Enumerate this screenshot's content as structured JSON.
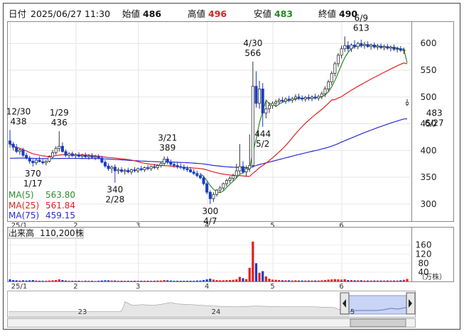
{
  "header": {
    "label_date": "日付",
    "date": "2025/06/27 11:30",
    "label_open": "始値",
    "open": "486",
    "label_high": "高値",
    "high": "496",
    "label_low": "安値",
    "low": "483",
    "label_close": "終値",
    "close": "490"
  },
  "legend": {
    "ma5_label": "MA(5)",
    "ma5_value": "563.80",
    "ma25_label": "MA(25)",
    "ma25_value": "561.84",
    "ma75_label": "MA(75)",
    "ma75_value": "459.15"
  },
  "volume_header": {
    "label": "出来高",
    "value": "110,200株"
  },
  "volume_unit": "（万株）",
  "colors": {
    "up": "#ffffff",
    "down": "#1a3cc8",
    "vol_up": "#e02020",
    "vol_down": "#1a3cc8",
    "ma5": "#2c8a2c",
    "ma25": "#e02020",
    "ma75": "#2a2ad8",
    "high_value": "#e02020",
    "low_value": "#228822"
  },
  "annotations": [
    {
      "date_label": "12/30",
      "value_label": "438",
      "position": "above"
    },
    {
      "date_label": "1/29",
      "value_label": "436",
      "position": "above"
    },
    {
      "date_label": "370",
      "value_label": "1/17",
      "position": "below"
    },
    {
      "date_label": "3/21",
      "value_label": "389",
      "position": "above"
    },
    {
      "date_label": "340",
      "value_label": "2/28",
      "position": "below"
    },
    {
      "date_label": "300",
      "value_label": "4/7",
      "position": "below"
    },
    {
      "date_label": "4/30",
      "value_label": "566",
      "position": "above"
    },
    {
      "date_label": "444",
      "value_label": "5/2",
      "position": "below"
    },
    {
      "date_label": "6/9",
      "value_label": "613",
      "position": "above"
    },
    {
      "date_label": "483",
      "value_label": "6/27",
      "position": "below"
    }
  ],
  "navigator": {
    "year_labels": [
      "23",
      "24",
      "5"
    ]
  },
  "chart_data": {
    "type": "candlestick",
    "title": "",
    "y_ticks": [
      300,
      350,
      400,
      450,
      500,
      550,
      600
    ],
    "ylim": [
      268,
      640
    ],
    "volume_ticks": [
      40,
      80,
      120,
      160
    ],
    "volume_ylim": [
      0,
      190
    ],
    "x_tick_labels": [
      "25/1",
      "2",
      "3",
      "4",
      "5",
      "6"
    ],
    "x_tick_days": [
      0,
      20,
      39,
      60,
      80,
      101
    ],
    "candles": [
      {
        "o": 418,
        "h": 438,
        "l": 405,
        "c": 412,
        "v": 9
      },
      {
        "o": 412,
        "h": 416,
        "l": 400,
        "c": 406,
        "v": 6
      },
      {
        "o": 406,
        "h": 412,
        "l": 395,
        "c": 398,
        "v": 5
      },
      {
        "o": 398,
        "h": 404,
        "l": 392,
        "c": 401,
        "v": 4
      },
      {
        "o": 401,
        "h": 405,
        "l": 388,
        "c": 391,
        "v": 5
      },
      {
        "o": 391,
        "h": 396,
        "l": 383,
        "c": 386,
        "v": 4
      },
      {
        "o": 386,
        "h": 390,
        "l": 375,
        "c": 380,
        "v": 5
      },
      {
        "o": 380,
        "h": 384,
        "l": 370,
        "c": 377,
        "v": 6
      },
      {
        "o": 377,
        "h": 385,
        "l": 373,
        "c": 382,
        "v": 4
      },
      {
        "o": 382,
        "h": 389,
        "l": 378,
        "c": 379,
        "v": 3
      },
      {
        "o": 379,
        "h": 384,
        "l": 374,
        "c": 377,
        "v": 3
      },
      {
        "o": 377,
        "h": 382,
        "l": 372,
        "c": 380,
        "v": 3
      },
      {
        "o": 380,
        "h": 391,
        "l": 378,
        "c": 388,
        "v": 4
      },
      {
        "o": 388,
        "h": 401,
        "l": 384,
        "c": 396,
        "v": 5
      },
      {
        "o": 396,
        "h": 408,
        "l": 392,
        "c": 404,
        "v": 6
      },
      {
        "o": 404,
        "h": 436,
        "l": 398,
        "c": 408,
        "v": 9
      },
      {
        "o": 408,
        "h": 415,
        "l": 396,
        "c": 398,
        "v": 6
      },
      {
        "o": 398,
        "h": 402,
        "l": 388,
        "c": 391,
        "v": 4
      },
      {
        "o": 391,
        "h": 397,
        "l": 386,
        "c": 394,
        "v": 3
      },
      {
        "o": 394,
        "h": 398,
        "l": 388,
        "c": 390,
        "v": 3
      },
      {
        "o": 390,
        "h": 395,
        "l": 385,
        "c": 392,
        "v": 3
      },
      {
        "o": 392,
        "h": 397,
        "l": 387,
        "c": 389,
        "v": 3
      },
      {
        "o": 389,
        "h": 394,
        "l": 384,
        "c": 391,
        "v": 2
      },
      {
        "o": 391,
        "h": 396,
        "l": 386,
        "c": 388,
        "v": 3
      },
      {
        "o": 388,
        "h": 393,
        "l": 383,
        "c": 390,
        "v": 3
      },
      {
        "o": 390,
        "h": 395,
        "l": 385,
        "c": 387,
        "v": 3
      },
      {
        "o": 387,
        "h": 392,
        "l": 382,
        "c": 389,
        "v": 2
      },
      {
        "o": 389,
        "h": 393,
        "l": 384,
        "c": 386,
        "v": 3
      },
      {
        "o": 386,
        "h": 390,
        "l": 376,
        "c": 378,
        "v": 4
      },
      {
        "o": 378,
        "h": 382,
        "l": 368,
        "c": 371,
        "v": 5
      },
      {
        "o": 371,
        "h": 376,
        "l": 362,
        "c": 366,
        "v": 5
      },
      {
        "o": 366,
        "h": 372,
        "l": 358,
        "c": 369,
        "v": 4
      },
      {
        "o": 369,
        "h": 374,
        "l": 340,
        "c": 362,
        "v": 4
      },
      {
        "o": 362,
        "h": 368,
        "l": 356,
        "c": 364,
        "v": 3
      },
      {
        "o": 364,
        "h": 369,
        "l": 358,
        "c": 361,
        "v": 3
      },
      {
        "o": 361,
        "h": 366,
        "l": 355,
        "c": 363,
        "v": 3
      },
      {
        "o": 363,
        "h": 368,
        "l": 357,
        "c": 360,
        "v": 3
      },
      {
        "o": 360,
        "h": 366,
        "l": 355,
        "c": 364,
        "v": 3
      },
      {
        "o": 364,
        "h": 369,
        "l": 359,
        "c": 362,
        "v": 3
      },
      {
        "o": 362,
        "h": 368,
        "l": 358,
        "c": 366,
        "v": 3
      },
      {
        "o": 366,
        "h": 371,
        "l": 361,
        "c": 364,
        "v": 3
      },
      {
        "o": 364,
        "h": 370,
        "l": 360,
        "c": 368,
        "v": 3
      },
      {
        "o": 368,
        "h": 373,
        "l": 363,
        "c": 366,
        "v": 3
      },
      {
        "o": 366,
        "h": 372,
        "l": 362,
        "c": 370,
        "v": 3
      },
      {
        "o": 370,
        "h": 375,
        "l": 365,
        "c": 368,
        "v": 3
      },
      {
        "o": 368,
        "h": 374,
        "l": 364,
        "c": 372,
        "v": 4
      },
      {
        "o": 372,
        "h": 378,
        "l": 368,
        "c": 376,
        "v": 4
      },
      {
        "o": 376,
        "h": 389,
        "l": 372,
        "c": 384,
        "v": 6
      },
      {
        "o": 384,
        "h": 389,
        "l": 374,
        "c": 378,
        "v": 5
      },
      {
        "o": 378,
        "h": 383,
        "l": 371,
        "c": 374,
        "v": 4
      },
      {
        "o": 374,
        "h": 379,
        "l": 368,
        "c": 372,
        "v": 3
      },
      {
        "o": 372,
        "h": 377,
        "l": 366,
        "c": 370,
        "v": 3
      },
      {
        "o": 370,
        "h": 376,
        "l": 365,
        "c": 369,
        "v": 3
      },
      {
        "o": 369,
        "h": 374,
        "l": 362,
        "c": 366,
        "v": 3
      },
      {
        "o": 366,
        "h": 371,
        "l": 360,
        "c": 364,
        "v": 3
      },
      {
        "o": 364,
        "h": 369,
        "l": 358,
        "c": 360,
        "v": 3
      },
      {
        "o": 360,
        "h": 365,
        "l": 354,
        "c": 357,
        "v": 3
      },
      {
        "o": 357,
        "h": 362,
        "l": 350,
        "c": 353,
        "v": 4
      },
      {
        "o": 353,
        "h": 358,
        "l": 346,
        "c": 349,
        "v": 4
      },
      {
        "o": 349,
        "h": 353,
        "l": 335,
        "c": 338,
        "v": 6
      },
      {
        "o": 338,
        "h": 342,
        "l": 318,
        "c": 322,
        "v": 9
      },
      {
        "o": 322,
        "h": 326,
        "l": 300,
        "c": 310,
        "v": 12
      },
      {
        "o": 310,
        "h": 322,
        "l": 304,
        "c": 318,
        "v": 8
      },
      {
        "o": 318,
        "h": 328,
        "l": 314,
        "c": 326,
        "v": 6
      },
      {
        "o": 326,
        "h": 334,
        "l": 321,
        "c": 330,
        "v": 5
      },
      {
        "o": 330,
        "h": 340,
        "l": 326,
        "c": 338,
        "v": 5
      },
      {
        "o": 338,
        "h": 347,
        "l": 333,
        "c": 344,
        "v": 6
      },
      {
        "o": 344,
        "h": 352,
        "l": 339,
        "c": 348,
        "v": 6
      },
      {
        "o": 348,
        "h": 357,
        "l": 343,
        "c": 353,
        "v": 7
      },
      {
        "o": 353,
        "h": 375,
        "l": 348,
        "c": 362,
        "v": 9
      },
      {
        "o": 362,
        "h": 412,
        "l": 356,
        "c": 370,
        "v": 20
      },
      {
        "o": 370,
        "h": 380,
        "l": 356,
        "c": 360,
        "v": 14
      },
      {
        "o": 360,
        "h": 372,
        "l": 352,
        "c": 366,
        "v": 10
      },
      {
        "o": 366,
        "h": 430,
        "l": 360,
        "c": 372,
        "v": 60
      },
      {
        "o": 372,
        "h": 566,
        "l": 368,
        "c": 520,
        "v": 175
      },
      {
        "o": 520,
        "h": 548,
        "l": 480,
        "c": 488,
        "v": 80
      },
      {
        "o": 488,
        "h": 530,
        "l": 478,
        "c": 515,
        "v": 38
      },
      {
        "o": 515,
        "h": 526,
        "l": 444,
        "c": 470,
        "v": 45
      },
      {
        "o": 470,
        "h": 492,
        "l": 460,
        "c": 478,
        "v": 22
      },
      {
        "o": 478,
        "h": 490,
        "l": 470,
        "c": 484,
        "v": 12
      },
      {
        "o": 484,
        "h": 492,
        "l": 478,
        "c": 488,
        "v": 8
      },
      {
        "o": 488,
        "h": 495,
        "l": 482,
        "c": 491,
        "v": 7
      },
      {
        "o": 491,
        "h": 498,
        "l": 486,
        "c": 494,
        "v": 6
      },
      {
        "o": 494,
        "h": 500,
        "l": 489,
        "c": 492,
        "v": 5
      },
      {
        "o": 492,
        "h": 499,
        "l": 487,
        "c": 496,
        "v": 5
      },
      {
        "o": 496,
        "h": 502,
        "l": 490,
        "c": 494,
        "v": 5
      },
      {
        "o": 494,
        "h": 500,
        "l": 489,
        "c": 497,
        "v": 4
      },
      {
        "o": 497,
        "h": 505,
        "l": 492,
        "c": 500,
        "v": 5
      },
      {
        "o": 500,
        "h": 506,
        "l": 494,
        "c": 498,
        "v": 4
      },
      {
        "o": 498,
        "h": 503,
        "l": 492,
        "c": 496,
        "v": 4
      },
      {
        "o": 496,
        "h": 502,
        "l": 491,
        "c": 499,
        "v": 4
      },
      {
        "o": 499,
        "h": 505,
        "l": 493,
        "c": 497,
        "v": 4
      },
      {
        "o": 497,
        "h": 503,
        "l": 492,
        "c": 500,
        "v": 4
      },
      {
        "o": 500,
        "h": 506,
        "l": 495,
        "c": 498,
        "v": 4
      },
      {
        "o": 498,
        "h": 504,
        "l": 493,
        "c": 501,
        "v": 4
      },
      {
        "o": 501,
        "h": 510,
        "l": 496,
        "c": 506,
        "v": 5
      },
      {
        "o": 506,
        "h": 520,
        "l": 500,
        "c": 515,
        "v": 6
      },
      {
        "o": 515,
        "h": 532,
        "l": 510,
        "c": 528,
        "v": 8
      },
      {
        "o": 528,
        "h": 548,
        "l": 522,
        "c": 544,
        "v": 9
      },
      {
        "o": 544,
        "h": 566,
        "l": 538,
        "c": 562,
        "v": 10
      },
      {
        "o": 562,
        "h": 582,
        "l": 556,
        "c": 578,
        "v": 9
      },
      {
        "o": 578,
        "h": 596,
        "l": 572,
        "c": 590,
        "v": 8
      },
      {
        "o": 590,
        "h": 613,
        "l": 584,
        "c": 596,
        "v": 10
      },
      {
        "o": 596,
        "h": 604,
        "l": 585,
        "c": 590,
        "v": 6
      },
      {
        "o": 590,
        "h": 600,
        "l": 584,
        "c": 597,
        "v": 6
      },
      {
        "o": 597,
        "h": 606,
        "l": 590,
        "c": 594,
        "v": 5
      },
      {
        "o": 594,
        "h": 603,
        "l": 589,
        "c": 600,
        "v": 5
      },
      {
        "o": 600,
        "h": 607,
        "l": 592,
        "c": 596,
        "v": 5
      },
      {
        "o": 596,
        "h": 603,
        "l": 590,
        "c": 598,
        "v": 4
      },
      {
        "o": 598,
        "h": 604,
        "l": 592,
        "c": 594,
        "v": 4
      },
      {
        "o": 594,
        "h": 600,
        "l": 588,
        "c": 597,
        "v": 4
      },
      {
        "o": 597,
        "h": 602,
        "l": 590,
        "c": 593,
        "v": 4
      },
      {
        "o": 593,
        "h": 599,
        "l": 588,
        "c": 595,
        "v": 4
      },
      {
        "o": 595,
        "h": 600,
        "l": 589,
        "c": 592,
        "v": 4
      },
      {
        "o": 592,
        "h": 598,
        "l": 587,
        "c": 594,
        "v": 4
      },
      {
        "o": 594,
        "h": 599,
        "l": 588,
        "c": 591,
        "v": 4
      },
      {
        "o": 591,
        "h": 596,
        "l": 585,
        "c": 593,
        "v": 4
      },
      {
        "o": 593,
        "h": 598,
        "l": 586,
        "c": 589,
        "v": 4
      },
      {
        "o": 589,
        "h": 594,
        "l": 583,
        "c": 590,
        "v": 4
      },
      {
        "o": 590,
        "h": 595,
        "l": 584,
        "c": 587,
        "v": 5
      },
      {
        "o": 587,
        "h": 592,
        "l": 580,
        "c": 588,
        "v": 7
      },
      {
        "o": 486,
        "h": 496,
        "l": 483,
        "c": 490,
        "v": 11
      }
    ],
    "ma5_last": 563.8,
    "ma25_last": 561.84,
    "ma75_last": 459.15,
    "ma75_start": 385
  }
}
